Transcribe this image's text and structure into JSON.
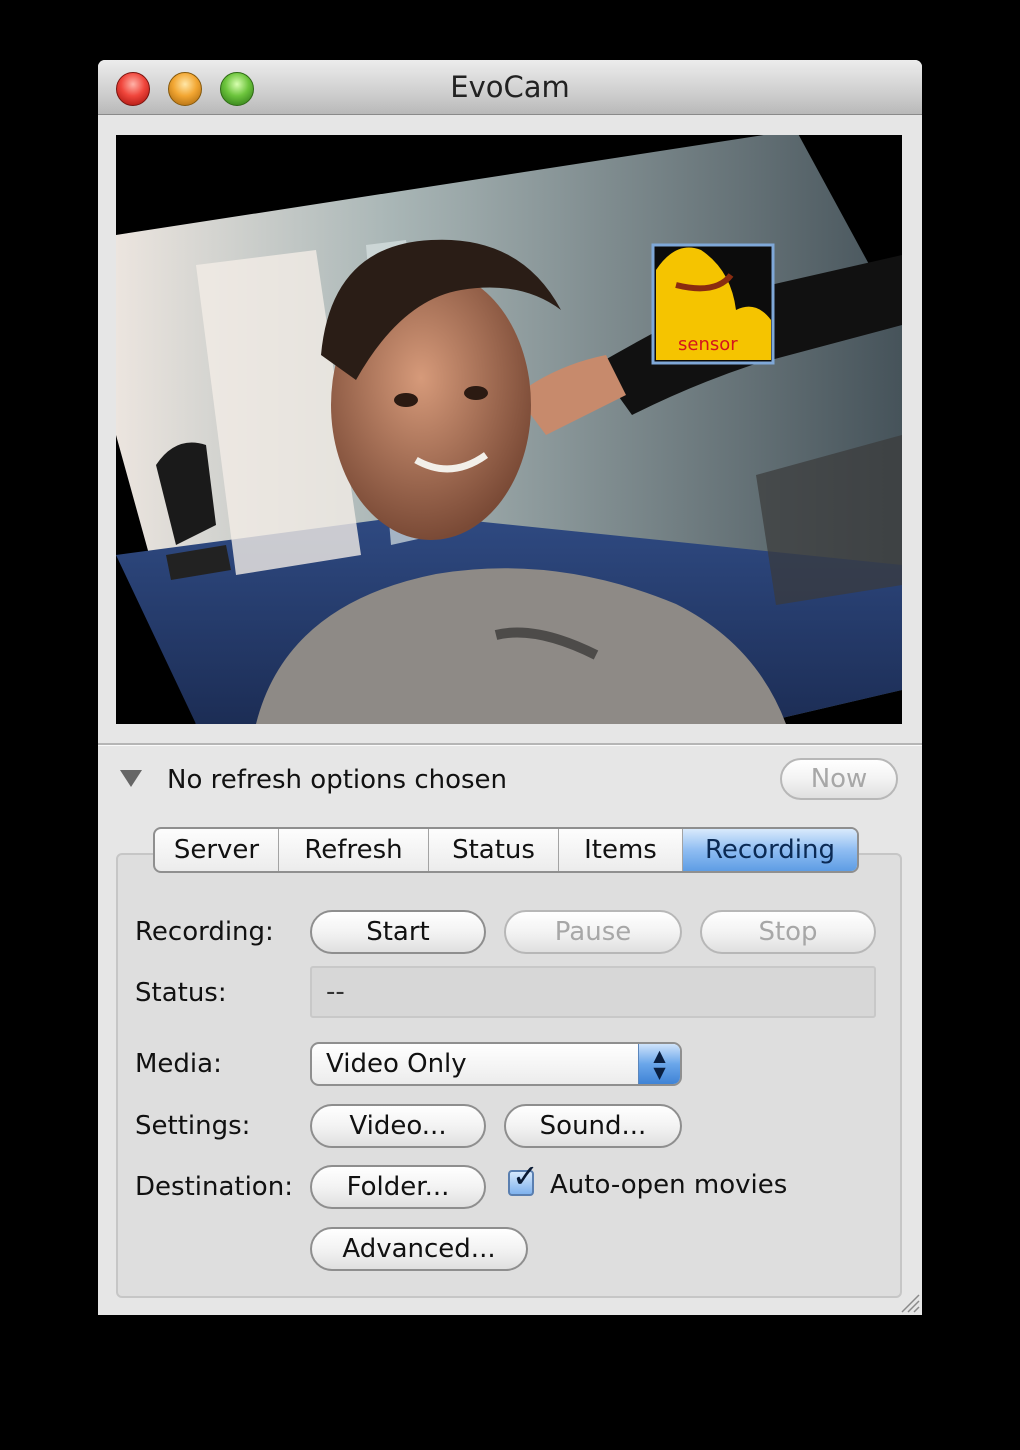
{
  "window": {
    "title": "EvoCam"
  },
  "camera": {
    "sensor_label": "sensor"
  },
  "refresh": {
    "text": "No refresh options chosen",
    "now_label": "Now"
  },
  "tabs": [
    {
      "label": "Server"
    },
    {
      "label": "Refresh"
    },
    {
      "label": "Status"
    },
    {
      "label": "Items"
    },
    {
      "label": "Recording",
      "active": true
    }
  ],
  "recording": {
    "recording_label": "Recording:",
    "start_label": "Start",
    "pause_label": "Pause",
    "stop_label": "Stop",
    "status_label": "Status:",
    "status_value": "--",
    "media_label": "Media:",
    "media_value": "Video Only",
    "settings_label": "Settings:",
    "video_label": "Video...",
    "sound_label": "Sound...",
    "destination_label": "Destination:",
    "folder_label": "Folder...",
    "auto_open_label": "Auto-open movies",
    "auto_open_checked": true,
    "advanced_label": "Advanced..."
  },
  "colors": {
    "active_tab": "#5e9de4",
    "sensor_fill": "#f5c400",
    "sensor_text": "#d4141c"
  }
}
